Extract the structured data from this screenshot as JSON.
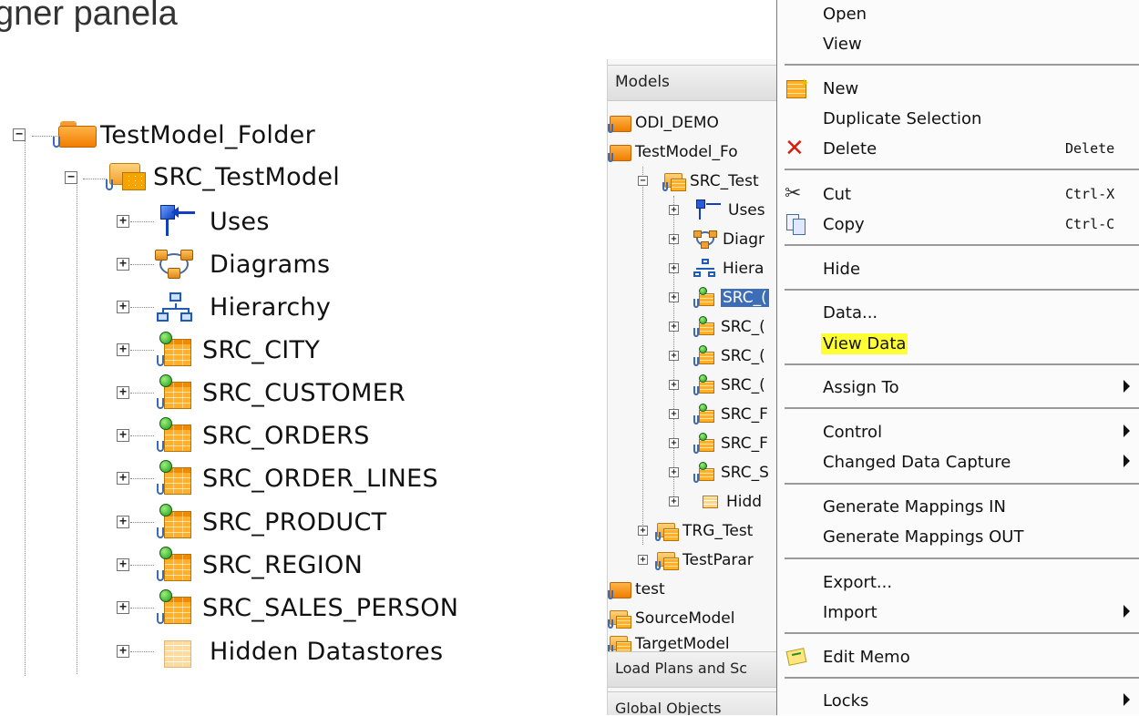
{
  "slide_title": "gner panela",
  "left_tree": {
    "root": "TestModel_Folder",
    "model": "SRC_TestModel",
    "children": [
      {
        "label": "Uses",
        "icon": "uses-icon"
      },
      {
        "label": "Diagrams",
        "icon": "diagrams-icon"
      },
      {
        "label": "Hierarchy",
        "icon": "hierarchy-icon"
      },
      {
        "label": "SRC_CITY",
        "icon": "datastore-icon"
      },
      {
        "label": "SRC_CUSTOMER",
        "icon": "datastore-icon"
      },
      {
        "label": "SRC_ORDERS",
        "icon": "datastore-icon"
      },
      {
        "label": "SRC_ORDER_LINES",
        "icon": "datastore-icon"
      },
      {
        "label": "SRC_PRODUCT",
        "icon": "datastore-icon"
      },
      {
        "label": "SRC_REGION",
        "icon": "datastore-icon"
      },
      {
        "label": "SRC_SALES_PERSON",
        "icon": "datastore-icon"
      },
      {
        "label": "Hidden Datastores",
        "icon": "hidden-datastore-icon"
      }
    ]
  },
  "models_panel": {
    "header": "Models",
    "items": [
      "ODI_DEMO",
      "TestModel_Fo",
      "SRC_Test",
      "Uses",
      "Diagr",
      "Hiera",
      "SRC_(",
      "SRC_(",
      "SRC_(",
      "SRC_(",
      "SRC_F",
      "SRC_F",
      "SRC_S",
      "Hidd",
      "TRG_Test",
      "TestParar",
      "test",
      "SourceModel",
      "TargetModel"
    ],
    "footer_tabs": [
      "Load Plans and Sc",
      "Global Objects"
    ]
  },
  "context_menu": {
    "open": "Open",
    "view": "View",
    "new": "New",
    "duplicate_selection": "Duplicate Selection",
    "delete": "Delete",
    "delete_shortcut": "Delete",
    "cut": "Cut",
    "cut_shortcut": "Ctrl-X",
    "copy": "Copy",
    "copy_shortcut": "Ctrl-C",
    "hide": "Hide",
    "data": "Data...",
    "view_data": "View Data",
    "assign_to": "Assign To",
    "control": "Control",
    "changed_data_capture": "Changed Data Capture",
    "gen_mappings_in": "Generate Mappings IN",
    "gen_mappings_out": "Generate Mappings OUT",
    "export": "Export...",
    "import": "Import",
    "edit_memo": "Edit Memo",
    "locks": "Locks",
    "highlight_color": "#ffff33",
    "selection_color": "#3d6db6"
  }
}
